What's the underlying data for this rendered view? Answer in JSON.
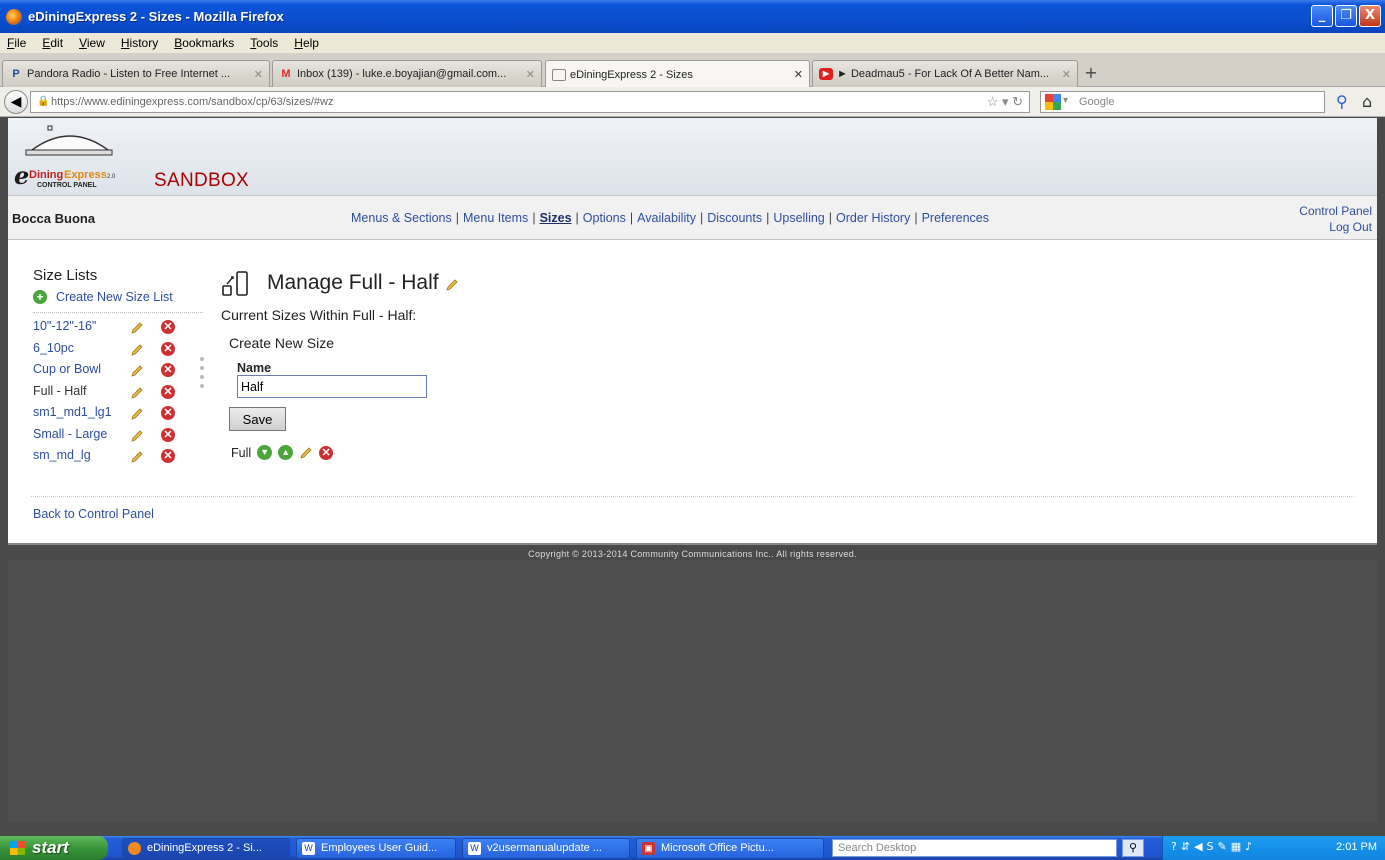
{
  "window": {
    "title": "eDiningExpress 2 - Sizes - Mozilla Firefox",
    "buttons": [
      "_",
      "❐",
      "X"
    ]
  },
  "menu": [
    "File",
    "Edit",
    "View",
    "History",
    "Bookmarks",
    "Tools",
    "Help"
  ],
  "tabs": [
    {
      "label": "Pandora Radio - Listen to Free Internet ...",
      "icon": "P"
    },
    {
      "label": "Inbox (139) - luke.e.boyajian@gmail.com...",
      "icon": "M"
    },
    {
      "label": "eDiningExpress 2 - Sizes",
      "icon": ""
    },
    {
      "label": "► Deadmau5 - For Lack Of A Better Nam...",
      "icon": "▶"
    }
  ],
  "nav": {
    "url": "https://www.ediningexpress.com/sandbox/cp/63/sizes/#wz",
    "search_placeholder": "Google"
  },
  "header": {
    "sandbox": "SANDBOX",
    "logo_text": "eDiningExpress",
    "logo_sub": "CONTROL PANEL"
  },
  "navstrip": {
    "restaurant": "Bocca Buona",
    "links": [
      "Menus & Sections",
      "Menu Items",
      "Sizes",
      "Options",
      "Availability",
      "Discounts",
      "Upselling",
      "Order History",
      "Preferences"
    ],
    "control_panel": "Control Panel",
    "log_out": "Log Out"
  },
  "sidebar": {
    "title": "Size Lists",
    "create": "Create New Size List",
    "items": [
      "10\"-12\"-16\"",
      "6_10pc",
      "Cup or Bowl",
      "Full - Half",
      "sm1_md1_lg1",
      "Small - Large",
      "sm_md_lg"
    ]
  },
  "main": {
    "title": "Manage Full - Half",
    "subtitle": "Current Sizes Within Full - Half:",
    "create_heading": "Create New Size",
    "name_label": "Name",
    "name_value": "Half",
    "save": "Save",
    "sizes": [
      "Full"
    ]
  },
  "footer": {
    "back": "Back to Control Panel",
    "copyright": "Copyright © 2013-2014 Community Communications Inc.. All rights reserved."
  },
  "taskbar": {
    "start": "start",
    "tasks": [
      "eDiningExpress 2 - Si...",
      "Employees User Guid...",
      "v2usermanualupdate ...",
      "Microsoft Office Pictu..."
    ],
    "search_placeholder": "Search Desktop",
    "clock": "2:01 PM"
  }
}
